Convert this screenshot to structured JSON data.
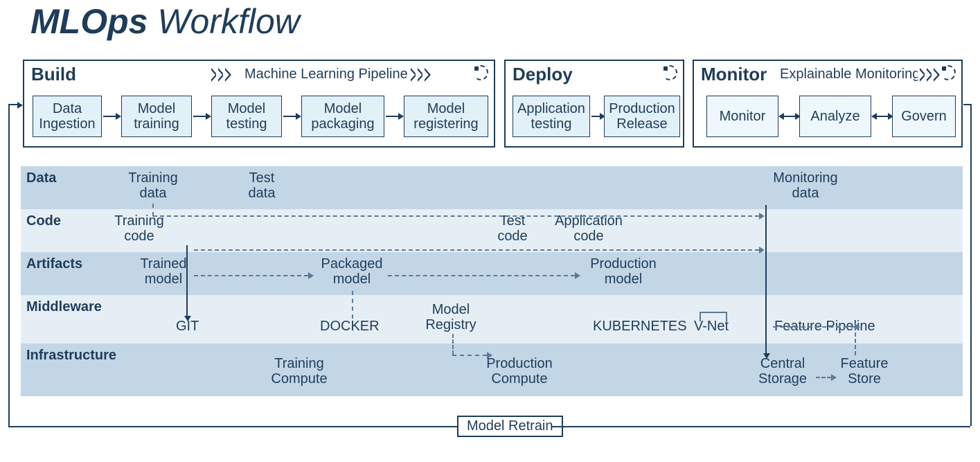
{
  "title_bold": "MLOps",
  "title_rest": " Workflow",
  "stages": {
    "build": {
      "title": "Build",
      "subtitle": "Machine Learning Pipeline",
      "boxes": [
        "Data Ingestion",
        "Model training",
        "Model testing",
        "Model packaging",
        "Model registering"
      ]
    },
    "deploy": {
      "title": "Deploy",
      "boxes": [
        "Application testing",
        "Production Release"
      ]
    },
    "monitor": {
      "title": "Monitor",
      "subtitle": "Explainable Monitoring",
      "boxes": [
        "Monitor",
        "Analyze",
        "Govern"
      ]
    }
  },
  "layers": {
    "data": {
      "label": "Data",
      "items": {
        "training_data": "Training data",
        "test_data": "Test data",
        "monitoring_data": "Monitoring data"
      }
    },
    "code": {
      "label": "Code",
      "items": {
        "training_code": "Training code",
        "test_code": "Test code",
        "application_code": "Application code"
      }
    },
    "artifacts": {
      "label": "Artifacts",
      "items": {
        "trained_model": "Trained model",
        "packaged_model": "Packaged model",
        "production_model": "Production model"
      }
    },
    "middleware": {
      "label": "Middleware",
      "items": {
        "git": "GIT",
        "docker": "DOCKER",
        "model_registry": "Model Registry",
        "kubernetes": "KUBERNETES",
        "vnet": "V-Net",
        "feature_pipeline": "Feature Pipeline"
      }
    },
    "infrastructure": {
      "label": "Infrastructure",
      "items": {
        "training_compute": "Training Compute",
        "production_compute": "Production Compute",
        "central_storage": "Central Storage",
        "feature_store": "Feature Store"
      }
    }
  },
  "retrain": "Model Retrain"
}
